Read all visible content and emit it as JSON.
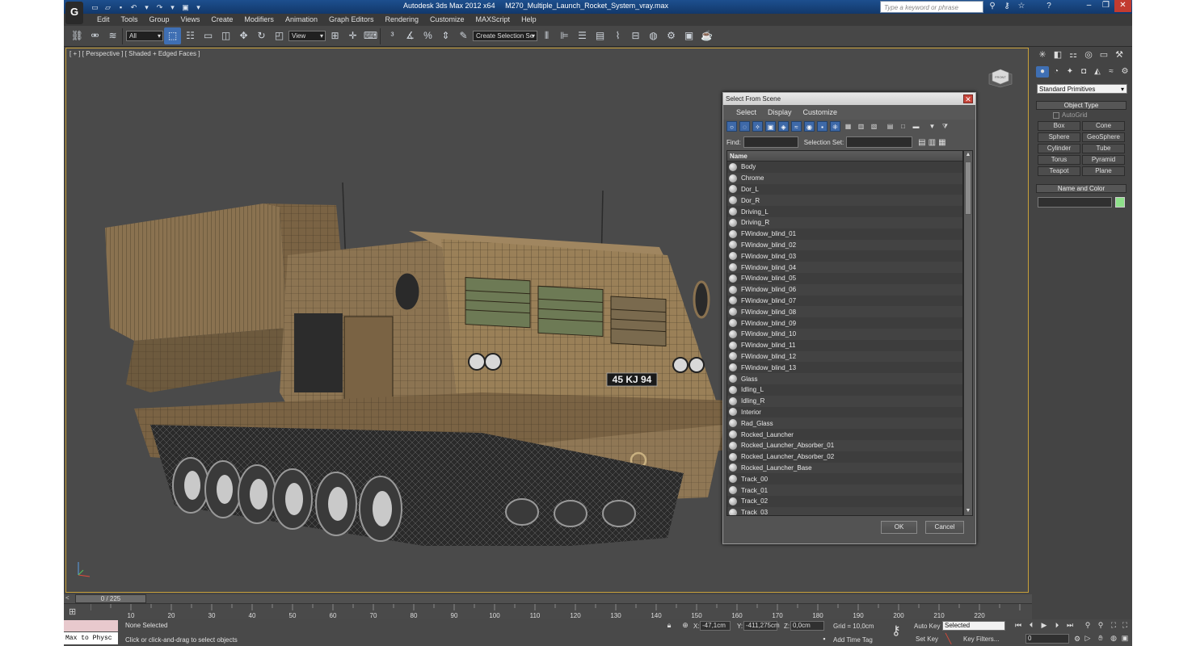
{
  "app": {
    "title": "Autodesk 3ds Max  2012 x64",
    "filename": "M270_Multiple_Launch_Rocket_System_vray.max",
    "logo_letter": "G",
    "help_search_placeholder": "Type a keyword or phrase"
  },
  "menu": [
    "Edit",
    "Tools",
    "Group",
    "Views",
    "Create",
    "Modifiers",
    "Animation",
    "Graph Editors",
    "Rendering",
    "Customize",
    "MAXScript",
    "Help"
  ],
  "toolbar": {
    "filter_select": "All",
    "reference_coord": "View",
    "named_selection": "Create Selection Se"
  },
  "viewport": {
    "label": "[ + ] [ Perspective ] [ Shaded + Edged Faces ]",
    "plate_text": "45 KJ 94",
    "colors": {
      "hull": "#8c7452",
      "wireframe": "#2e2618",
      "border": "#c8a03a"
    }
  },
  "dialog": {
    "title": "Select From Scene",
    "menu": [
      "Select",
      "Display",
      "Customize"
    ],
    "find_label": "Find:",
    "selection_set_label": "Selection Set:",
    "column_name": "Name",
    "items": [
      "Body",
      "Chrome",
      "Dor_L",
      "Dor_R",
      "Driving_L",
      "Driving_R",
      "FWindow_blind_01",
      "FWindow_blind_02",
      "FWindow_blind_03",
      "FWindow_blind_04",
      "FWindow_blind_05",
      "FWindow_blind_06",
      "FWindow_blind_07",
      "FWindow_blind_08",
      "FWindow_blind_09",
      "FWindow_blind_10",
      "FWindow_blind_11",
      "FWindow_blind_12",
      "FWindow_blind_13",
      "Glass",
      "Idling_L",
      "Idling_R",
      "Interior",
      "Rad_Glass",
      "Rocked_Launcher",
      "Rocked_Launcher_Absorber_01",
      "Rocked_Launcher_Absorber_02",
      "Rocked_Launcher_Base",
      "Track_00",
      "Track_01",
      "Track_02",
      "Track_03"
    ],
    "ok_label": "OK",
    "cancel_label": "Cancel"
  },
  "command_panel": {
    "primitives_dropdown": "Standard Primitives",
    "object_type_label": "Object Type",
    "autogrid_label": "AutoGrid",
    "buttons": [
      "Box",
      "Cone",
      "Sphere",
      "GeoSphere",
      "Cylinder",
      "Tube",
      "Torus",
      "Pyramid",
      "Teapot",
      "Plane"
    ],
    "name_color_label": "Name and Color",
    "object_color": "#8ee08a"
  },
  "timeline": {
    "frame_display": "0 / 225",
    "ticks": [
      "10",
      "20",
      "30",
      "40",
      "50",
      "60",
      "70",
      "80",
      "90",
      "100",
      "110",
      "120",
      "130",
      "140",
      "150",
      "160",
      "170",
      "180",
      "190",
      "200",
      "210",
      "220"
    ]
  },
  "status": {
    "maxscript_label": "Max to Physc",
    "selection_status": "None Selected",
    "prompt": "Click or click-and-drag to select objects",
    "x_label": "X:",
    "x_value": "-47,1cm",
    "y_label": "Y:",
    "y_value": "-411,275cm",
    "z_label": "Z:",
    "z_value": "0,0cm",
    "grid": "Grid = 10,0cm",
    "add_time_tag": "Add Time Tag",
    "auto_key": "Auto Key",
    "set_key": "Set Key",
    "key_mode": "Selected",
    "key_filters": "Key Filters...",
    "current_frame": "0"
  }
}
